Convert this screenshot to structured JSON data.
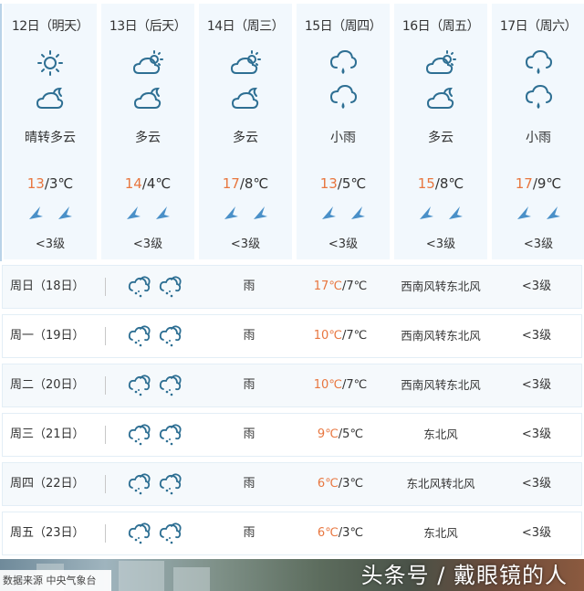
{
  "colors": {
    "accent_high_temp": "#e8763f",
    "icon_stroke": "#2e6f93",
    "wind_arrow": "#4a90c8",
    "card_bg": "#f2f8fd"
  },
  "forecast_days": [
    {
      "date": "12日（明天）",
      "icon_day": "sun-icon",
      "icon_night": "cloudy-night-icon",
      "condition": "晴转多云",
      "high": "13",
      "low": "/3℃",
      "wind_level": "<3级"
    },
    {
      "date": "13日（后天）",
      "icon_day": "partly-cloudy-icon",
      "icon_night": "cloudy-night-icon",
      "condition": "多云",
      "high": "14",
      "low": "/4℃",
      "wind_level": "<3级"
    },
    {
      "date": "14日（周三）",
      "icon_day": "partly-cloudy-icon",
      "icon_night": "cloudy-night-icon",
      "condition": "多云",
      "high": "17",
      "low": "/8℃",
      "wind_level": "<3级"
    },
    {
      "date": "15日（周四）",
      "icon_day": "light-rain-icon",
      "icon_night": "light-rain-icon",
      "condition": "小雨",
      "high": "13",
      "low": "/5℃",
      "wind_level": "<3级"
    },
    {
      "date": "16日（周五）",
      "icon_day": "partly-cloudy-icon",
      "icon_night": "cloudy-night-icon",
      "condition": "多云",
      "high": "15",
      "low": "/8℃",
      "wind_level": "<3级"
    },
    {
      "date": "17日（周六）",
      "icon_day": "light-rain-icon",
      "icon_night": "light-rain-icon",
      "condition": "小雨",
      "high": "17",
      "low": "/9℃",
      "wind_level": "<3级"
    }
  ],
  "extended_days": [
    {
      "day": "周日（18日）",
      "condition": "雨",
      "high": "17℃",
      "low": "/7℃",
      "wind": "西南风转东北风",
      "level": "<3级"
    },
    {
      "day": "周一（19日）",
      "condition": "雨",
      "high": "10℃",
      "low": "/7℃",
      "wind": "西南风转东北风",
      "level": "<3级"
    },
    {
      "day": "周二（20日）",
      "condition": "雨",
      "high": "10℃",
      "low": "/7℃",
      "wind": "西南风转东北风",
      "level": "<3级"
    },
    {
      "day": "周三（21日）",
      "condition": "雨",
      "high": "9℃",
      "low": "/5℃",
      "wind": "东北风",
      "level": "<3级"
    },
    {
      "day": "周四（22日）",
      "condition": "雨",
      "high": "6℃",
      "low": "/3℃",
      "wind": "东北风转北风",
      "level": "<3级"
    },
    {
      "day": "周五（23日）",
      "condition": "雨",
      "high": "6℃",
      "low": "/3℃",
      "wind": "东北风",
      "level": "<3级"
    }
  ],
  "footer": {
    "source": "数据来源 中央气象台",
    "watermark": "头条号 / 戴眼镜的人"
  }
}
